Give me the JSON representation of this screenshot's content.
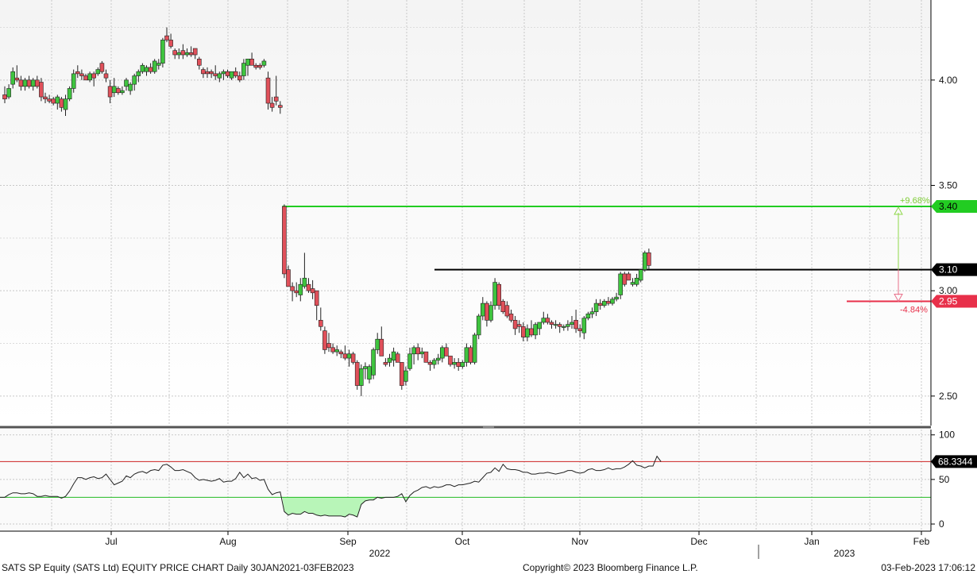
{
  "footer": {
    "left": "SATS SP Equity (SATS Ltd) EQUITY PRICE CHART  Daily 30JAN2021-03FEB2023",
    "center": "Copyright© 2023 Bloomberg Finance L.P.",
    "right": "03-Feb-2023 17:06:12"
  },
  "colors": {
    "up": "#3fc43f",
    "down": "#e0505a",
    "resistance": "#22cc22",
    "pivot": "#000000",
    "support": "#e8304a",
    "rsi_line": "#222222",
    "rsi_upper": "#cc2222",
    "rsi_lower": "#22bb22",
    "rsi_fill": "#b8f5b8"
  },
  "chart_data": [
    {
      "type": "candlestick",
      "name": "price",
      "y_ticks": [
        "2.50",
        "3.00",
        "3.50",
        "4.00"
      ],
      "ylim": [
        2.36,
        4.38
      ],
      "x_ticks": [
        "Jul",
        "Aug",
        "Sep",
        "Oct",
        "Nov",
        "Dec",
        "Jan",
        "Feb"
      ],
      "year_labels": [
        "2022",
        "2023"
      ],
      "grid": true,
      "candles": [
        [
          3.93,
          3.97,
          3.89,
          3.91
        ],
        [
          3.92,
          3.98,
          3.91,
          3.96
        ],
        [
          3.98,
          4.06,
          3.96,
          4.04
        ],
        [
          4.01,
          4.07,
          3.99,
          4.0
        ],
        [
          4.0,
          4.02,
          3.95,
          3.97
        ],
        [
          3.97,
          4.01,
          3.95,
          4.0
        ],
        [
          4.0,
          4.02,
          3.96,
          3.97
        ],
        [
          3.97,
          4.01,
          3.95,
          4.0
        ],
        [
          4.0,
          4.02,
          3.96,
          3.97
        ],
        [
          3.99,
          4.01,
          3.9,
          3.92
        ],
        [
          3.92,
          3.94,
          3.89,
          3.91
        ],
        [
          3.91,
          3.93,
          3.89,
          3.9
        ],
        [
          3.91,
          3.92,
          3.88,
          3.89
        ],
        [
          3.89,
          3.93,
          3.86,
          3.92
        ],
        [
          3.91,
          3.92,
          3.85,
          3.87
        ],
        [
          3.86,
          3.93,
          3.83,
          3.91
        ],
        [
          3.91,
          3.97,
          3.9,
          3.96
        ],
        [
          3.96,
          4.05,
          3.94,
          4.03
        ],
        [
          4.04,
          4.07,
          4.01,
          4.03
        ],
        [
          4.03,
          4.05,
          4.0,
          4.02
        ],
        [
          4.02,
          4.03,
          4.0,
          4.0
        ],
        [
          4.0,
          4.04,
          3.99,
          4.03
        ],
        [
          4.03,
          4.04,
          3.97,
          4.01
        ],
        [
          4.03,
          4.06,
          4.02,
          4.05
        ],
        [
          4.08,
          4.09,
          4.03,
          4.04
        ],
        [
          4.03,
          4.05,
          3.99,
          4.01
        ],
        [
          3.97,
          4.0,
          3.89,
          3.92
        ],
        [
          3.94,
          4.01,
          3.92,
          3.97
        ],
        [
          3.96,
          3.97,
          3.93,
          3.94
        ],
        [
          3.94,
          3.97,
          3.93,
          3.95
        ],
        [
          3.97,
          4.01,
          3.95,
          4.0
        ],
        [
          3.95,
          3.99,
          3.93,
          3.98
        ],
        [
          3.98,
          4.03,
          3.95,
          4.02
        ],
        [
          4.02,
          4.05,
          3.99,
          4.04
        ],
        [
          4.04,
          4.08,
          4.03,
          4.07
        ],
        [
          4.04,
          4.07,
          4.02,
          4.06
        ],
        [
          4.06,
          4.08,
          4.03,
          4.04
        ],
        [
          4.04,
          4.1,
          4.03,
          4.09
        ],
        [
          4.07,
          4.1,
          4.05,
          4.08
        ],
        [
          4.08,
          4.2,
          4.06,
          4.19
        ],
        [
          4.21,
          4.25,
          4.18,
          4.19
        ],
        [
          4.19,
          4.22,
          4.15,
          4.16
        ],
        [
          4.14,
          4.15,
          4.1,
          4.12
        ],
        [
          4.12,
          4.15,
          4.1,
          4.13
        ],
        [
          4.14,
          4.17,
          4.1,
          4.12
        ],
        [
          4.12,
          4.15,
          4.11,
          4.13
        ],
        [
          4.13,
          4.16,
          4.11,
          4.12
        ],
        [
          4.15,
          4.15,
          4.1,
          4.12
        ],
        [
          4.1,
          4.11,
          4.05,
          4.07
        ],
        [
          4.05,
          4.06,
          4.01,
          4.03
        ],
        [
          4.04,
          4.06,
          4.01,
          4.03
        ],
        [
          4.04,
          4.05,
          4.01,
          4.03
        ],
        [
          4.03,
          4.07,
          4.0,
          4.02
        ],
        [
          4.01,
          4.04,
          3.99,
          4.03
        ],
        [
          4.03,
          4.05,
          4.0,
          4.04
        ],
        [
          4.04,
          4.05,
          4.01,
          4.02
        ],
        [
          4.01,
          4.04,
          4.0,
          4.04
        ],
        [
          4.04,
          4.06,
          4.01,
          4.02
        ],
        [
          4.02,
          4.04,
          3.99,
          4.0
        ],
        [
          4.02,
          4.1,
          4.0,
          4.08
        ],
        [
          4.07,
          4.1,
          4.02,
          4.1
        ],
        [
          4.1,
          4.13,
          4.07,
          4.07
        ],
        [
          4.07,
          4.08,
          4.05,
          4.06
        ],
        [
          4.07,
          4.08,
          4.05,
          4.06
        ],
        [
          4.07,
          4.1,
          4.06,
          4.09
        ],
        [
          4.01,
          4.04,
          3.86,
          3.89
        ],
        [
          3.89,
          3.92,
          3.85,
          3.87
        ],
        [
          3.92,
          4.02,
          3.88,
          3.9
        ],
        [
          3.88,
          3.9,
          3.84,
          3.87
        ],
        [
          3.4,
          3.41,
          3.06,
          3.08
        ],
        [
          3.1,
          3.12,
          3.02,
          3.02
        ],
        [
          3.02,
          3.04,
          2.95,
          3.0
        ],
        [
          3.0,
          3.04,
          2.97,
          2.99
        ],
        [
          2.98,
          3.06,
          2.95,
          3.03
        ],
        [
          3.02,
          3.18,
          3.01,
          3.06
        ],
        [
          3.03,
          3.06,
          2.99,
          3.0
        ],
        [
          3.01,
          3.05,
          2.96,
          2.99
        ],
        [
          3.0,
          3.0,
          2.86,
          2.93
        ],
        [
          2.86,
          2.92,
          2.81,
          2.83
        ],
        [
          2.81,
          2.83,
          2.7,
          2.72
        ],
        [
          2.75,
          2.8,
          2.71,
          2.73
        ],
        [
          2.73,
          2.75,
          2.7,
          2.71
        ],
        [
          2.71,
          2.74,
          2.69,
          2.72
        ],
        [
          2.71,
          2.72,
          2.68,
          2.7
        ],
        [
          2.7,
          2.74,
          2.67,
          2.68
        ],
        [
          2.68,
          2.72,
          2.64,
          2.7
        ],
        [
          2.7,
          2.71,
          2.65,
          2.66
        ],
        [
          2.66,
          2.67,
          2.53,
          2.55
        ],
        [
          2.55,
          2.65,
          2.5,
          2.63
        ],
        [
          2.63,
          2.66,
          2.58,
          2.64
        ],
        [
          2.58,
          2.65,
          2.56,
          2.64
        ],
        [
          2.6,
          2.73,
          2.58,
          2.72
        ],
        [
          2.72,
          2.8,
          2.7,
          2.77
        ],
        [
          2.77,
          2.83,
          2.69,
          2.69
        ],
        [
          2.66,
          2.68,
          2.64,
          2.65
        ],
        [
          2.66,
          2.7,
          2.64,
          2.68
        ],
        [
          2.67,
          2.73,
          2.64,
          2.71
        ],
        [
          2.7,
          2.71,
          2.66,
          2.66
        ],
        [
          2.66,
          2.66,
          2.53,
          2.55
        ],
        [
          2.57,
          2.64,
          2.55,
          2.62
        ],
        [
          2.63,
          2.73,
          2.62,
          2.7
        ],
        [
          2.7,
          2.74,
          2.65,
          2.73
        ],
        [
          2.73,
          2.75,
          2.67,
          2.7
        ],
        [
          2.7,
          2.73,
          2.68,
          2.71
        ],
        [
          2.71,
          2.71,
          2.66,
          2.66
        ],
        [
          2.66,
          2.67,
          2.62,
          2.65
        ],
        [
          2.65,
          2.68,
          2.63,
          2.67
        ],
        [
          2.67,
          2.7,
          2.65,
          2.68
        ],
        [
          2.68,
          2.74,
          2.66,
          2.73
        ],
        [
          2.73,
          2.75,
          2.69,
          2.69
        ],
        [
          2.69,
          2.69,
          2.64,
          2.65
        ],
        [
          2.65,
          2.68,
          2.63,
          2.66
        ],
        [
          2.66,
          2.68,
          2.62,
          2.64
        ],
        [
          2.64,
          2.67,
          2.63,
          2.66
        ],
        [
          2.66,
          2.75,
          2.64,
          2.73
        ],
        [
          2.73,
          2.74,
          2.65,
          2.66
        ],
        [
          2.66,
          2.8,
          2.65,
          2.79
        ],
        [
          2.79,
          2.89,
          2.77,
          2.88
        ],
        [
          2.88,
          2.97,
          2.86,
          2.94
        ],
        [
          2.94,
          2.95,
          2.83,
          2.86
        ],
        [
          2.86,
          2.95,
          2.85,
          2.93
        ],
        [
          2.93,
          3.06,
          2.91,
          3.04
        ],
        [
          3.03,
          3.04,
          2.91,
          2.93
        ],
        [
          2.95,
          2.96,
          2.89,
          2.9
        ],
        [
          2.93,
          2.95,
          2.87,
          2.88
        ],
        [
          2.89,
          2.91,
          2.85,
          2.86
        ],
        [
          2.86,
          2.88,
          2.79,
          2.82
        ],
        [
          2.84,
          2.86,
          2.8,
          2.83
        ],
        [
          2.83,
          2.85,
          2.76,
          2.78
        ],
        [
          2.78,
          2.84,
          2.76,
          2.82
        ],
        [
          2.82,
          2.86,
          2.78,
          2.79
        ],
        [
          2.79,
          2.85,
          2.77,
          2.84
        ],
        [
          2.82,
          2.85,
          2.79,
          2.85
        ],
        [
          2.85,
          2.9,
          2.84,
          2.87
        ],
        [
          2.87,
          2.89,
          2.84,
          2.85
        ],
        [
          2.85,
          2.86,
          2.82,
          2.84
        ],
        [
          2.84,
          2.86,
          2.82,
          2.84
        ],
        [
          2.84,
          2.85,
          2.8,
          2.83
        ],
        [
          2.83,
          2.84,
          2.81,
          2.83
        ],
        [
          2.83,
          2.86,
          2.81,
          2.84
        ],
        [
          2.84,
          2.88,
          2.82,
          2.85
        ],
        [
          2.86,
          2.91,
          2.8,
          2.82
        ],
        [
          2.82,
          2.84,
          2.78,
          2.81
        ],
        [
          2.8,
          2.88,
          2.77,
          2.87
        ],
        [
          2.87,
          2.9,
          2.86,
          2.89
        ],
        [
          2.89,
          2.92,
          2.87,
          2.9
        ],
        [
          2.9,
          2.96,
          2.88,
          2.94
        ],
        [
          2.94,
          2.96,
          2.91,
          2.93
        ],
        [
          2.93,
          2.96,
          2.92,
          2.95
        ],
        [
          2.95,
          2.97,
          2.93,
          2.94
        ],
        [
          2.94,
          2.97,
          2.93,
          2.96
        ],
        [
          2.96,
          2.99,
          2.95,
          2.97
        ],
        [
          2.98,
          3.09,
          2.96,
          3.08
        ],
        [
          3.08,
          3.09,
          3.02,
          3.03
        ],
        [
          3.08,
          3.09,
          3.05,
          3.05
        ],
        [
          3.03,
          3.06,
          3.02,
          3.04
        ],
        [
          3.03,
          3.08,
          3.02,
          3.06
        ],
        [
          3.05,
          3.1,
          3.04,
          3.1
        ],
        [
          3.1,
          3.19,
          3.09,
          3.18
        ],
        [
          3.18,
          3.2,
          3.1,
          3.12
        ]
      ],
      "levels": [
        {
          "name": "resistance",
          "value": 3.4,
          "label": "3.40",
          "change": "+9.68%"
        },
        {
          "name": "current",
          "value": 3.1,
          "label": "3.10"
        },
        {
          "name": "support",
          "value": 2.95,
          "label": "2.95",
          "change": "-4.84%"
        }
      ]
    },
    {
      "type": "line",
      "name": "RSI",
      "y_ticks": [
        "100",
        "50",
        "0"
      ],
      "ylim": [
        -8,
        106
      ],
      "upper": 70,
      "lower": 30,
      "last_label": "68.3344",
      "values": [
        30,
        33,
        35,
        35,
        34,
        34,
        35,
        34,
        31,
        31,
        32,
        31,
        31,
        31,
        29,
        31,
        37,
        45,
        52,
        52,
        50,
        52,
        53,
        51,
        52,
        56,
        50,
        44,
        46,
        48,
        54,
        52,
        56,
        58,
        59,
        57,
        60,
        61,
        60,
        66,
        67,
        64,
        60,
        60,
        61,
        59,
        57,
        52,
        49,
        50,
        49,
        48,
        49,
        51,
        47,
        48,
        48,
        51,
        58,
        52,
        56,
        51,
        52,
        49,
        50,
        39,
        33,
        35,
        36,
        14,
        10,
        12,
        11,
        11,
        14,
        12,
        12,
        10,
        9,
        10,
        9,
        9,
        9,
        9,
        8,
        11,
        10,
        8,
        22,
        26,
        27,
        27,
        30,
        29,
        30,
        30,
        30,
        31,
        34,
        25,
        32,
        36,
        38,
        41,
        42,
        40,
        42,
        41,
        42,
        44,
        44,
        42,
        44,
        44,
        45,
        46,
        48,
        47,
        52,
        57,
        58,
        63,
        59,
        67,
        62,
        61,
        61,
        60,
        58,
        58,
        56,
        56,
        57,
        57,
        58,
        57,
        56,
        57,
        58,
        60,
        60,
        58,
        57,
        58,
        61,
        62,
        60,
        60,
        61,
        63,
        61,
        62,
        62,
        64,
        67,
        71,
        66,
        65,
        63,
        65,
        65,
        76,
        70
      ]
    }
  ]
}
